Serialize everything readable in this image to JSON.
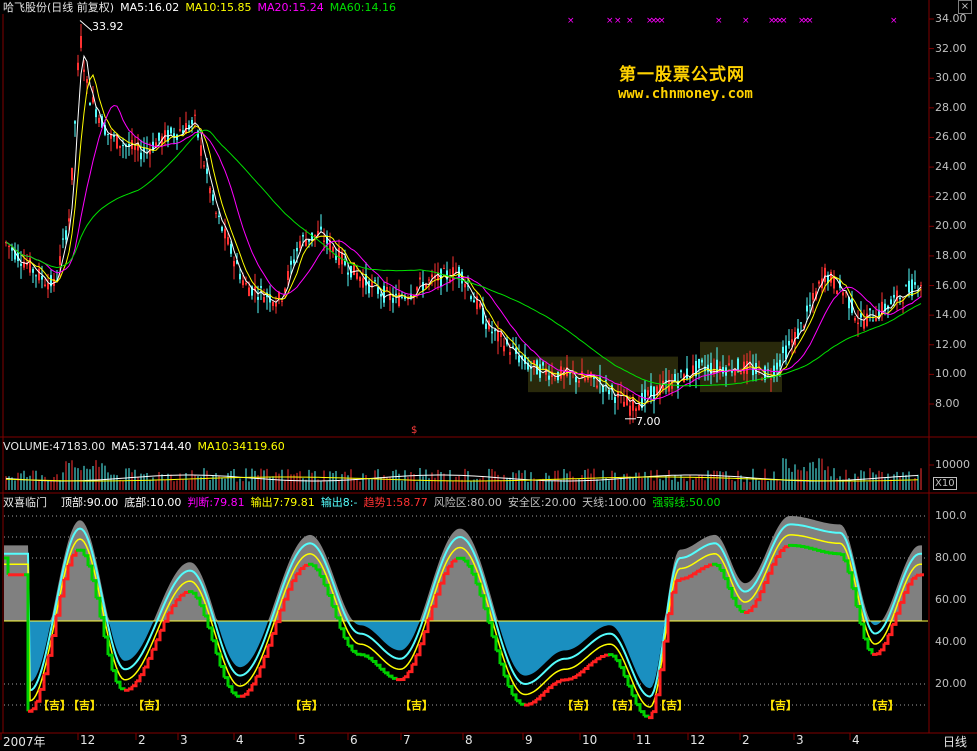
{
  "main_header": {
    "title": "哈飞股份(日线 前复权)",
    "ma5": "MA5:16.02",
    "ma10": "MA10:15.85",
    "ma20": "MA20:15.24",
    "ma60": "MA60:14.16"
  },
  "watermark": {
    "line1": "第一股票公式网",
    "line2": "www.chnmoney.com"
  },
  "price_axis": {
    "ticks": [
      "34.00",
      "32.00",
      "30.00",
      "28.00",
      "26.00",
      "24.00",
      "22.00",
      "20.00",
      "18.00",
      "16.00",
      "14.00",
      "12.00",
      "10.00",
      "8.00"
    ],
    "high_label": "33.92",
    "low_label": "7.00"
  },
  "dividend_marker": "$",
  "volume_header": {
    "volume": "VOLUME:47183.00",
    "ma5": "MA5:37144.40",
    "ma10": "MA10:34119.60"
  },
  "volume_axis": {
    "tick": "10000",
    "unit": "X10"
  },
  "indicator_header": {
    "name": "双喜临门",
    "top": "顶部:90.00",
    "bottom": "底部:10.00",
    "judge": "判断:79.81",
    "out7": "输出7:79.81",
    "out8": "输出8:-",
    "trend": "趋势1:58.77",
    "risk": "风险区:80.00",
    "safe": "安全区:20.00",
    "sky": "天线:100.00",
    "strong": "强弱线:50.00"
  },
  "indicator_axis": {
    "ticks": [
      "100.0",
      "80.00",
      "60.00",
      "40.00",
      "20.00"
    ]
  },
  "signal_label": "【吉】",
  "x_axis": {
    "labels": [
      "2007年",
      "12",
      "2",
      "3",
      "4",
      "5",
      "6",
      "7",
      "8",
      "9",
      "10",
      "11",
      "12",
      "2",
      "3",
      "4"
    ],
    "period": "日线"
  },
  "colors": {
    "up": "#ff3232",
    "down": "#54fcfc",
    "ma5": "#ffffff",
    "ma10": "#ffff00",
    "ma20": "#ff00ff",
    "ma60": "#00e000",
    "grid": "#800000"
  }
}
